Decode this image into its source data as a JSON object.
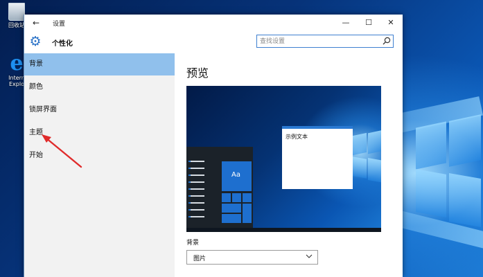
{
  "desktop": {
    "icons": [
      {
        "label": "回收站",
        "icon": "recycle-bin-icon"
      },
      {
        "label": "Intern\nExplo",
        "icon": "internet-explorer-icon"
      }
    ]
  },
  "window": {
    "title": "设置",
    "controls": {
      "minimize": "—",
      "maximize": "☐",
      "close": "✕"
    },
    "back_icon": "back-arrow-icon"
  },
  "header": {
    "page_title": "个性化",
    "gear_icon": "gear-icon",
    "search_placeholder": "查找设置"
  },
  "sidebar": {
    "items": [
      {
        "label": "背景",
        "active": true
      },
      {
        "label": "颜色",
        "active": false
      },
      {
        "label": "锁屏界面",
        "active": false
      },
      {
        "label": "主题",
        "active": false
      },
      {
        "label": "开始",
        "active": false
      }
    ]
  },
  "content": {
    "section_title": "预览",
    "preview": {
      "sample_text": "示例文本",
      "tile_label": "Aa"
    },
    "background_field": {
      "label": "背景",
      "value": "图片"
    }
  },
  "colors": {
    "accent": "#2a79d2",
    "sidebar_active": "#90c0ec",
    "annotation": "#e02b2b"
  }
}
